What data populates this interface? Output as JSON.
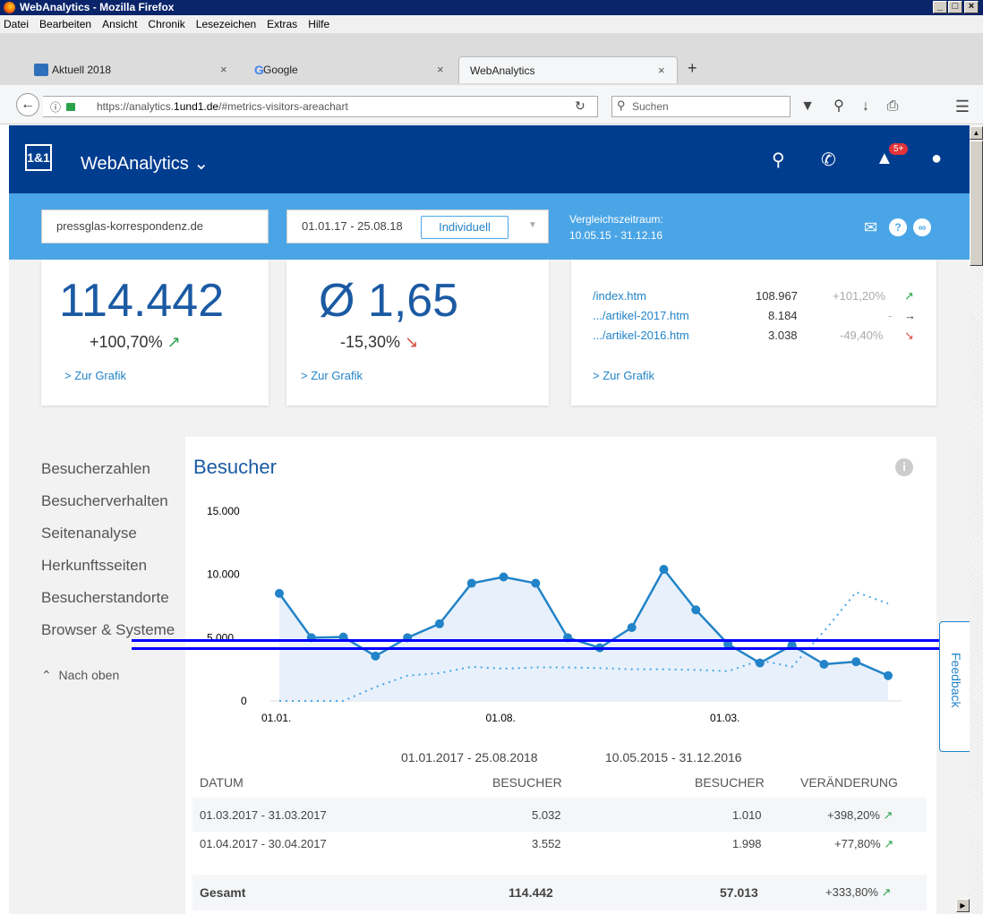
{
  "window": {
    "title": "WebAnalytics - Mozilla Firefox"
  },
  "menu": [
    "Datei",
    "Bearbeiten",
    "Ansicht",
    "Chronik",
    "Lesezeichen",
    "Extras",
    "Hilfe"
  ],
  "tabs": [
    {
      "label": "Aktuell 2018",
      "icon": "blue-square-icon"
    },
    {
      "label": "Google",
      "icon": "google-g-icon"
    },
    {
      "label": "WebAnalytics",
      "icon": ""
    }
  ],
  "urlbar": {
    "url_prefix": "https://analytics.",
    "url_host": "1und1.de",
    "url_path": "/#metrics-visitors-areachart"
  },
  "search": {
    "placeholder": "Suchen"
  },
  "app": {
    "logo": "1&1",
    "title": "WebAnalytics",
    "badge": "5+"
  },
  "filter": {
    "domain": "pressglas-korrespondenz.de",
    "range": "01.01.17 - 25.08.18",
    "mode": "Individuell",
    "compare_label": "Vergleichszeitraum:",
    "compare_range": "10.05.15 - 31.12.16"
  },
  "cards": {
    "visitors": {
      "value": "114.442",
      "change": "+100,70%",
      "link": "> Zur Grafik"
    },
    "avg": {
      "value": "Ø 1,65",
      "change": "-15,30%",
      "link": "> Zur Grafik"
    },
    "pages": {
      "rows": [
        {
          "page": "/index.htm",
          "count": "108.967",
          "change": "+101,20%"
        },
        {
          "page": ".../artikel-2017.htm",
          "count": "8.184",
          "change": "-"
        },
        {
          "page": ".../artikel-2016.htm",
          "count": "3.038",
          "change": "-49,40%"
        }
      ],
      "link": "> Zur Grafik"
    }
  },
  "sidebar": {
    "items": [
      "Besucherzahlen",
      "Besucherverhalten",
      "Seitenanalyse",
      "Herkunftsseiten",
      "Besucherstandorte",
      "Browser & Systeme"
    ],
    "back": "Nach oben"
  },
  "feedback": "Feedback",
  "chart_data": {
    "type": "area",
    "title": "Besucher",
    "ylim": [
      0,
      15000
    ],
    "yticks": [
      "0",
      "5.000",
      "10.000",
      "15.000"
    ],
    "xticks": [
      "01.01.",
      "01.08.",
      "01.03."
    ],
    "series": [
      {
        "values": [
          8500,
          5000,
          5050,
          3550,
          5000,
          6100,
          9300,
          9800,
          9300,
          5000,
          4200,
          5800,
          10400,
          7200,
          4500,
          3000,
          4400,
          2900,
          3100,
          2000
        ]
      },
      {
        "values": [
          0,
          0,
          0,
          1100,
          2000,
          2200,
          2700,
          2550,
          2650,
          2650,
          2600,
          2500,
          2500,
          2450,
          2350,
          3200,
          2700,
          5500,
          8600,
          7700
        ]
      }
    ]
  },
  "table": {
    "period_a": "01.01.2017 - 25.08.2018",
    "period_b": "10.05.2015 - 31.12.2016",
    "headers": [
      "DATUM",
      "BESUCHER",
      "BESUCHER",
      "VERÄNDERUNG"
    ],
    "rows": [
      {
        "date": "01.03.2017 - 31.03.2017",
        "a": "5.032",
        "b": "1.010",
        "change": "+398,20%"
      },
      {
        "date": "01.04.2017 - 30.04.2017",
        "a": "3.552",
        "b": "1.998",
        "change": "+77,80%"
      }
    ],
    "total": {
      "label": "Gesamt",
      "a": "114.442",
      "b": "57.013",
      "change": "+333,80%"
    }
  },
  "colors": {
    "header": "#003d8f",
    "filter": "#4aa5e6",
    "accent": "#2283c8",
    "up": "#2aa24b",
    "down": "#d64b3a"
  }
}
